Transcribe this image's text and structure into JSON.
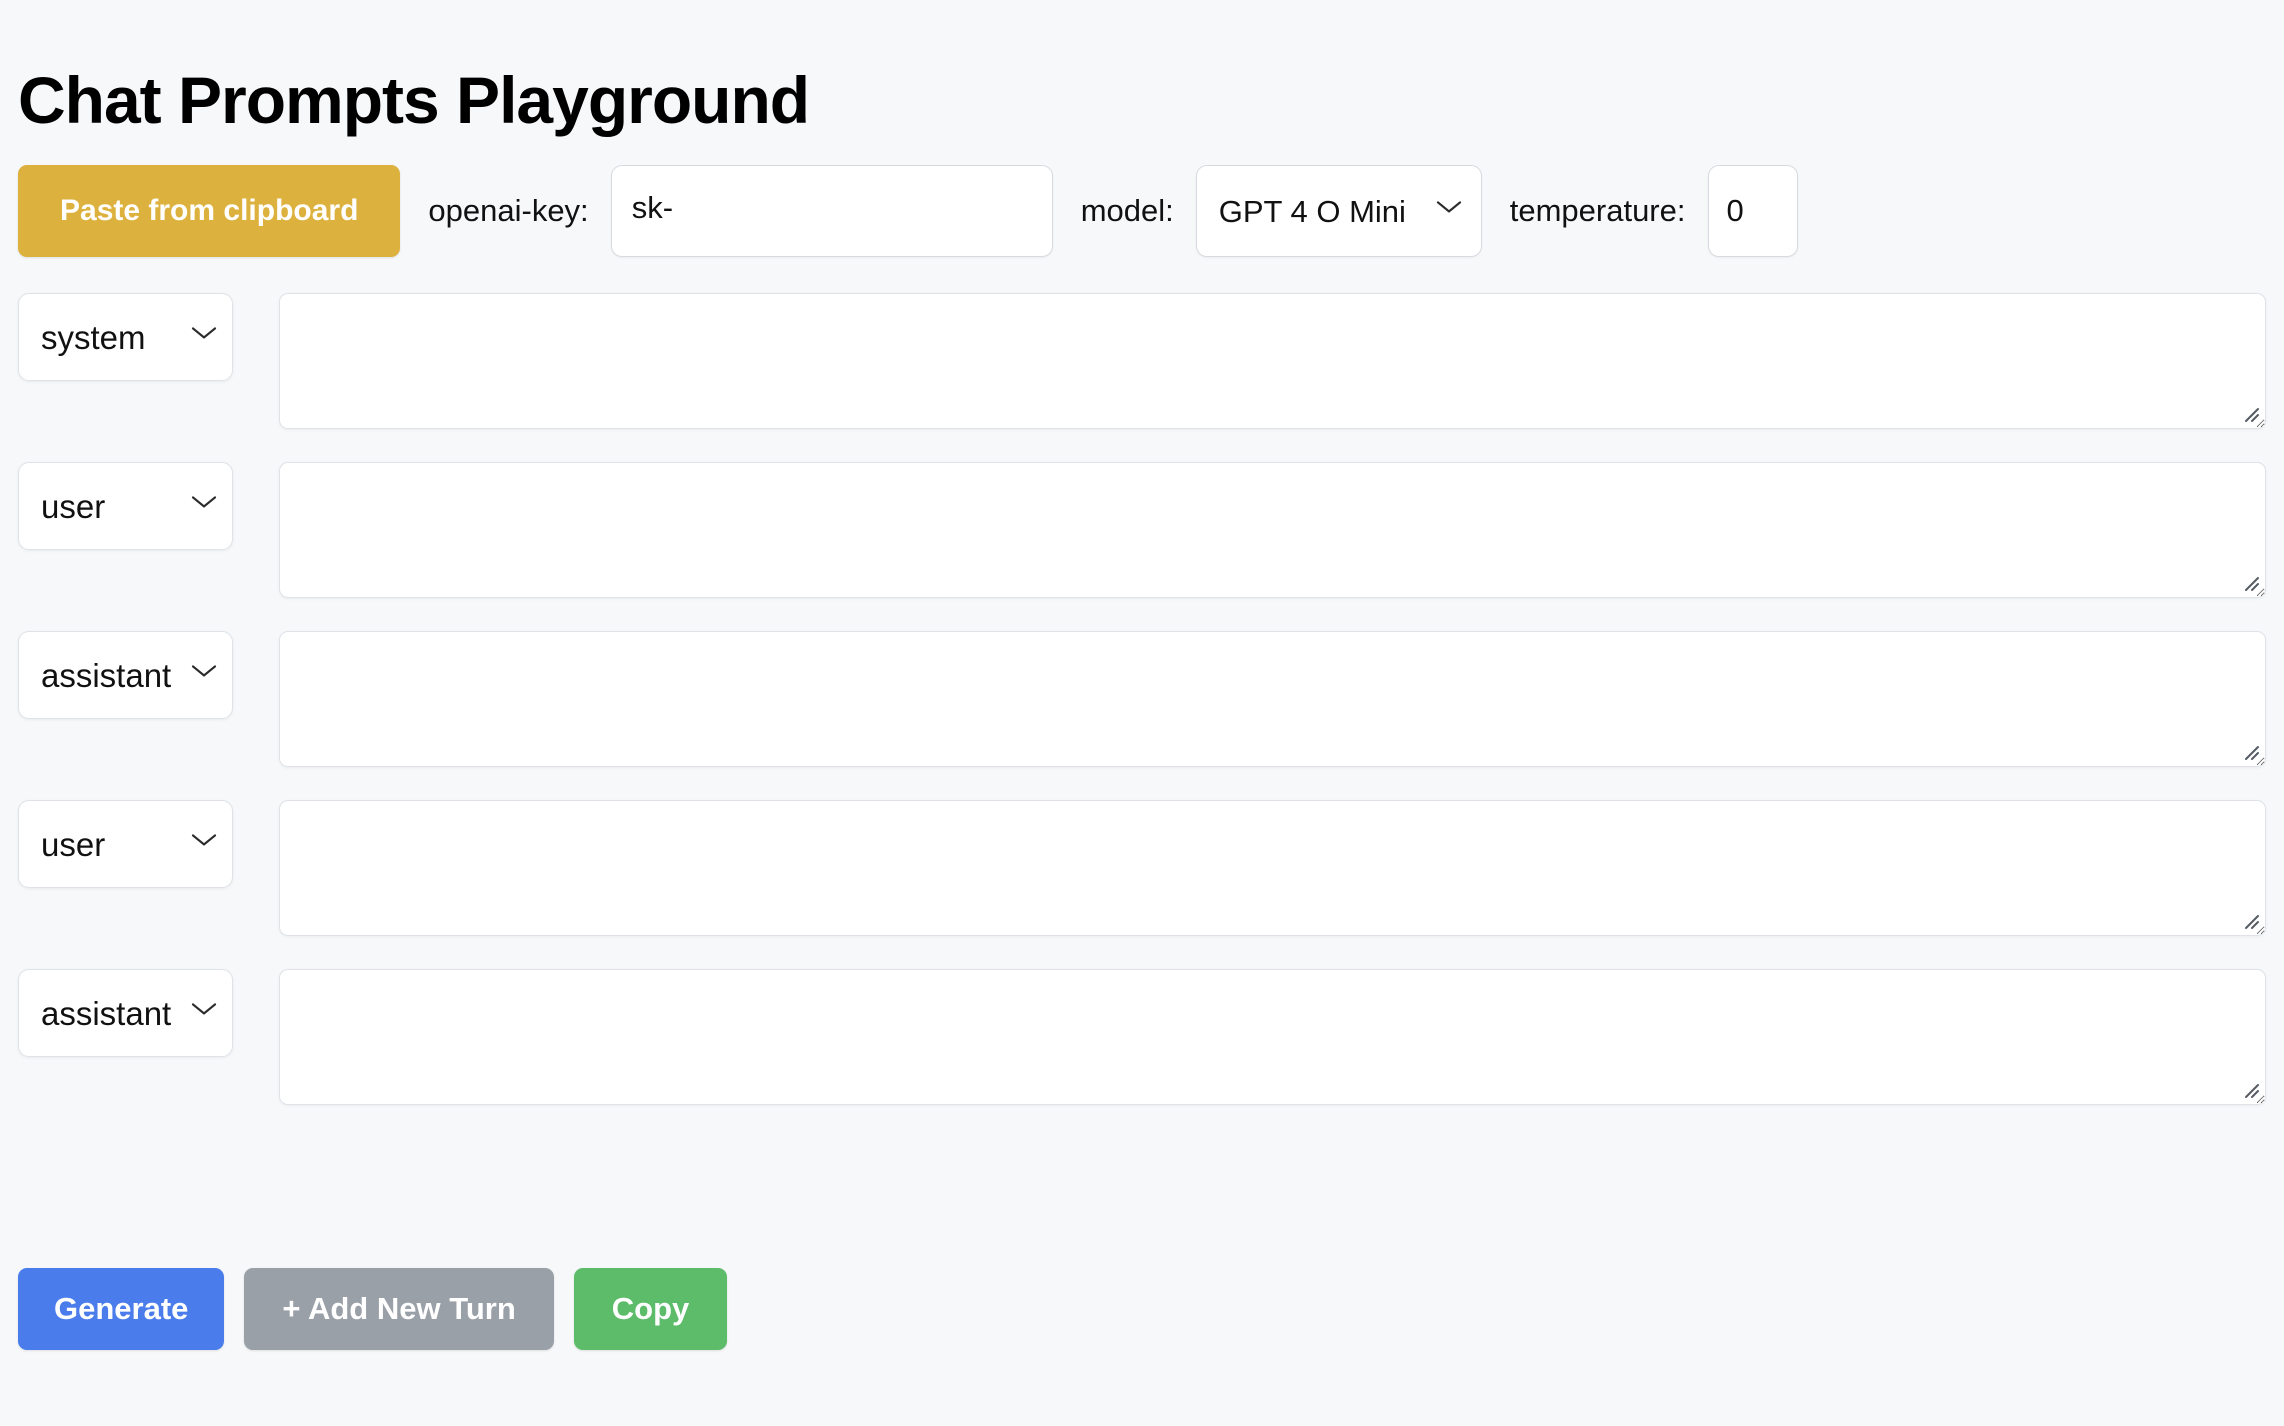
{
  "page": {
    "title": "Chat Prompts Playground",
    "background_color": "#f7f8fa"
  },
  "toolbar": {
    "paste_button_label": "Paste from clipboard",
    "paste_button_color": "#ddb13d",
    "openai_key_label": "openai-key:",
    "openai_key_value": "sk-",
    "openai_key_placeholder": "",
    "model_label": "model:",
    "model_value": "GPT 4 O Mini",
    "model_options": [
      "GPT 4 O Mini"
    ],
    "temperature_label": "temperature:",
    "temperature_value": "0"
  },
  "messages": [
    {
      "role": "system",
      "content": "",
      "placeholder": ""
    },
    {
      "role": "user",
      "content": "",
      "placeholder": ""
    },
    {
      "role": "assistant",
      "content": "",
      "placeholder": ""
    },
    {
      "role": "user",
      "content": "",
      "placeholder": ""
    },
    {
      "role": "assistant",
      "content": "",
      "placeholder": ""
    }
  ],
  "role_options": [
    "system",
    "user",
    "assistant"
  ],
  "actions": {
    "generate_label": "Generate",
    "generate_color": "#4a7ceb",
    "add_turn_label": "+ Add New Turn",
    "add_turn_color": "#9aa0a8",
    "copy_label": "Copy",
    "copy_color": "#5cbc69"
  }
}
